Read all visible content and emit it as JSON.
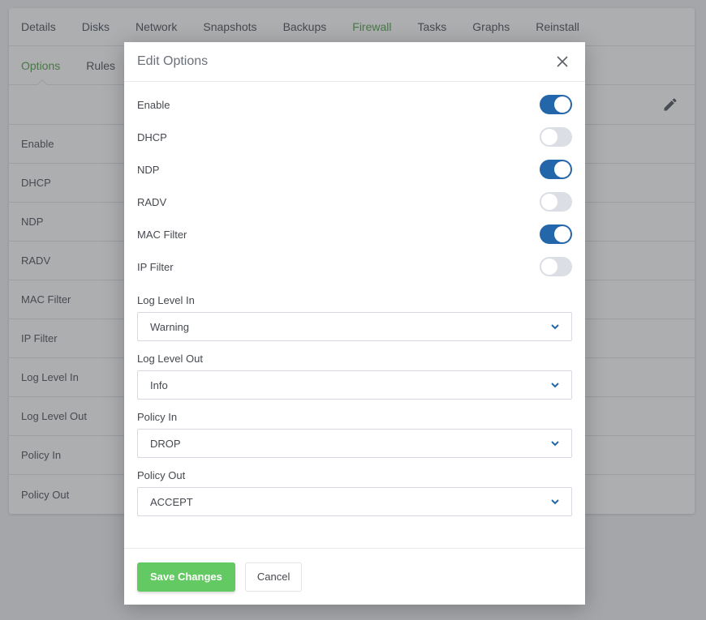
{
  "background": {
    "tabs": [
      {
        "label": "Details",
        "active": false
      },
      {
        "label": "Disks",
        "active": false
      },
      {
        "label": "Network",
        "active": false
      },
      {
        "label": "Snapshots",
        "active": false
      },
      {
        "label": "Backups",
        "active": false
      },
      {
        "label": "Firewall",
        "active": true
      },
      {
        "label": "Tasks",
        "active": false
      },
      {
        "label": "Graphs",
        "active": false
      },
      {
        "label": "Reinstall",
        "active": false
      }
    ],
    "subtabs": [
      {
        "label": "Options",
        "active": true
      },
      {
        "label": "Rules",
        "active": false
      }
    ],
    "edit_icon": "pencil-icon",
    "option_rows": [
      {
        "label": "Enable"
      },
      {
        "label": "DHCP"
      },
      {
        "label": "NDP"
      },
      {
        "label": "RADV"
      },
      {
        "label": "MAC Filter"
      },
      {
        "label": "IP Filter"
      },
      {
        "label": "Log Level In"
      },
      {
        "label": "Log Level Out"
      },
      {
        "label": "Policy In"
      },
      {
        "label": "Policy Out"
      }
    ]
  },
  "modal": {
    "title": "Edit Options",
    "close_icon": "close-icon",
    "toggles": [
      {
        "label": "Enable",
        "on": true
      },
      {
        "label": "DHCP",
        "on": false
      },
      {
        "label": "NDP",
        "on": true
      },
      {
        "label": "RADV",
        "on": false
      },
      {
        "label": "MAC Filter",
        "on": true
      },
      {
        "label": "IP Filter",
        "on": false
      }
    ],
    "selects": [
      {
        "label": "Log Level In",
        "value": "Warning"
      },
      {
        "label": "Log Level Out",
        "value": "Info"
      },
      {
        "label": "Policy In",
        "value": "DROP"
      },
      {
        "label": "Policy Out",
        "value": "ACCEPT"
      }
    ],
    "save_label": "Save Changes",
    "cancel_label": "Cancel"
  },
  "colors": {
    "accent_green": "#5fa65a",
    "toggle_on": "#2466aa",
    "toggle_off": "#dcdee6",
    "save_button": "#63c962",
    "chevron": "#2466aa"
  }
}
